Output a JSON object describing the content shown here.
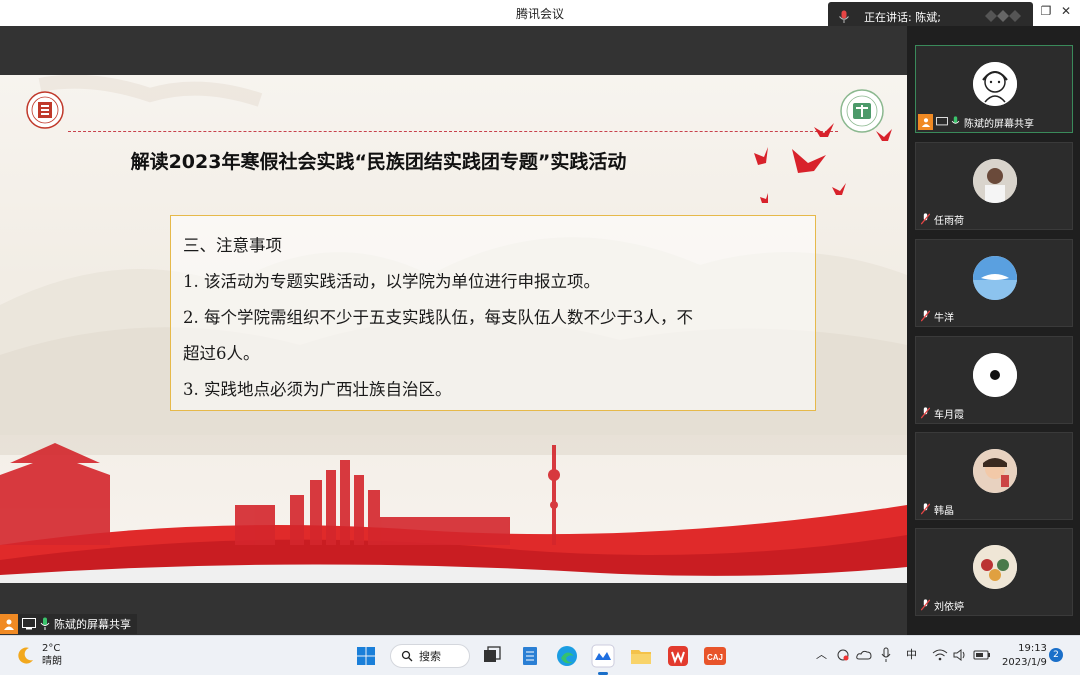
{
  "window": {
    "title": "腾讯会议",
    "speaking_label": "正在讲话: 陈斌;"
  },
  "slide": {
    "title": "解读2023年寒假社会实践“民族团结实践团专题”实践活动",
    "notice_lines": [
      "三、注意事项",
      "1. 该活动为专题实践活动，以学院为单位进行申报立项。",
      "2. 每个学院需组织不少于五支实践队伍，每支队伍人数不少于3人，不",
      "超过6人。",
      "3. 实践地点必须为广西壮族自治区。"
    ]
  },
  "share_label": "陈斌的屏幕共享",
  "participants": [
    {
      "name": "陈斌的屏幕共享",
      "avatar": "cartoon-girl"
    },
    {
      "name": "任雨荷",
      "avatar": "photo-person"
    },
    {
      "name": "牛洋",
      "avatar": "sky-bird"
    },
    {
      "name": "车月霞",
      "avatar": "black-dot"
    },
    {
      "name": "韩晶",
      "avatar": "photo-child"
    },
    {
      "name": "刘依婷",
      "avatar": "cartoon-group"
    }
  ],
  "taskbar": {
    "weather_temp": "2°C",
    "weather_desc": "晴朗",
    "search_label": "搜索",
    "ime": "中",
    "time": "19:13",
    "date": "2023/1/9",
    "notification_count": "2",
    "app_icons": [
      "windows-start-icon",
      "task-view-icon",
      "notes-icon",
      "edge-icon",
      "tencent-meeting-icon",
      "file-explorer-icon",
      "wps-icon",
      "caj-icon"
    ]
  },
  "colors": {
    "accent_red": "#d8222b",
    "notice_border": "#e6b94a",
    "taskbar_bg": "#eef1f6",
    "share_orange": "#f08a24"
  }
}
